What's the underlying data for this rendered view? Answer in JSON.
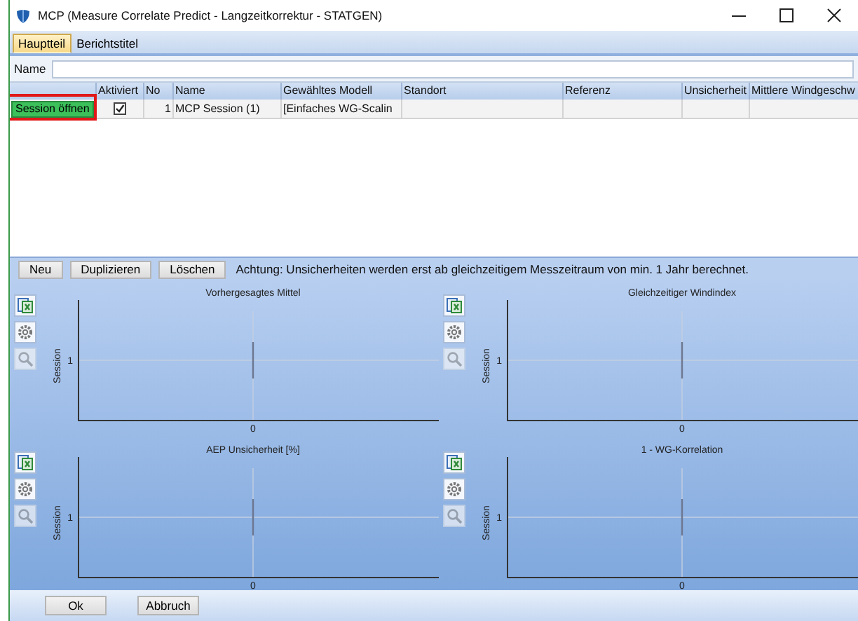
{
  "window": {
    "title": "MCP (Measure Correlate Predict - Langzeitkorrektur - STATGEN)"
  },
  "tabs": [
    {
      "label": "Hauptteil",
      "selected": true
    },
    {
      "label": "Berichtstitel",
      "selected": false
    }
  ],
  "name_field": {
    "label": "Name"
  },
  "table": {
    "columns": [
      "Aktiviert",
      "No",
      "Name",
      "Gewähltes Modell",
      "Standort",
      "Referenz",
      "Unsicherheit",
      "Mittlere Windgeschw"
    ],
    "rows": [
      {
        "action": "Session öffnen",
        "highlighted": true,
        "activated": true,
        "no": "1",
        "name": "MCP Session (1)",
        "model": "[Einfaches WG-Scalin"
      }
    ]
  },
  "actions": [
    "Neu",
    "Duplizieren",
    "Löschen"
  ],
  "notice": "Achtung: Unsicherheiten werden erst ab gleichzeitigem Messzeitraum von min. 1 Jahr berechnet.",
  "charts": [
    {
      "tools": [
        {
          "kind": "export",
          "disabled": false
        },
        {
          "kind": "settings",
          "disabled": false
        },
        {
          "kind": "zoom",
          "disabled": true
        }
      ],
      "plot": {
        "title": "Vorhergesagtes Mittel",
        "y_axis_title": "Session",
        "y_label": "1",
        "x_label": "0"
      }
    },
    {
      "tools": [
        {
          "kind": "export",
          "disabled": false
        },
        {
          "kind": "settings",
          "disabled": false
        },
        {
          "kind": "zoom",
          "disabled": true
        }
      ],
      "plot": {
        "title": "Gleichzeitiger Windindex",
        "y_axis_title": "Session",
        "y_label": "1",
        "x_label": "0"
      }
    },
    {
      "tools": [
        {
          "kind": "export",
          "disabled": false
        },
        {
          "kind": "settings",
          "disabled": false
        },
        {
          "kind": "zoom",
          "disabled": true
        }
      ],
      "plot": {
        "title": "AEP Unsicherheit [%]",
        "y_axis_title": "Session",
        "y_label": "1",
        "x_label": "0"
      }
    },
    {
      "tools": [
        {
          "kind": "export",
          "disabled": false
        },
        {
          "kind": "settings",
          "disabled": false
        },
        {
          "kind": "zoom",
          "disabled": true
        }
      ],
      "plot": {
        "title": "1 - WG-Korrelation",
        "y_axis_title": "Session",
        "y_label": "1",
        "x_label": "0"
      }
    }
  ],
  "buttons": [
    "Ok",
    "Abbruch"
  ]
}
